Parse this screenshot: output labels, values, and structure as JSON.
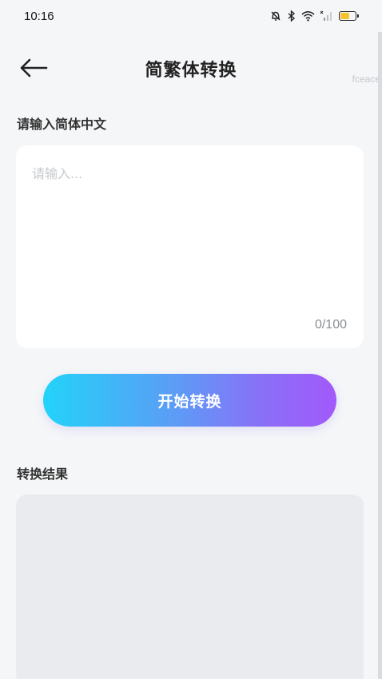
{
  "status_bar": {
    "time": "10:16",
    "icons": [
      "bell-off-icon",
      "bluetooth-icon",
      "wifi-icon",
      "signal-icon",
      "battery-icon"
    ],
    "battery_color": "#f4c430"
  },
  "header": {
    "back_icon": "arrow-left-icon",
    "title": "简繁体转换"
  },
  "watermark": "fceace",
  "input_section": {
    "label": "请输入简体中文",
    "placeholder": "请输入...",
    "value": "",
    "char_count": "0/100"
  },
  "convert_button": {
    "label": "开始转换",
    "gradient": [
      "#22d3f9",
      "#a259fb"
    ]
  },
  "result_section": {
    "label": "转换结果",
    "value": ""
  }
}
